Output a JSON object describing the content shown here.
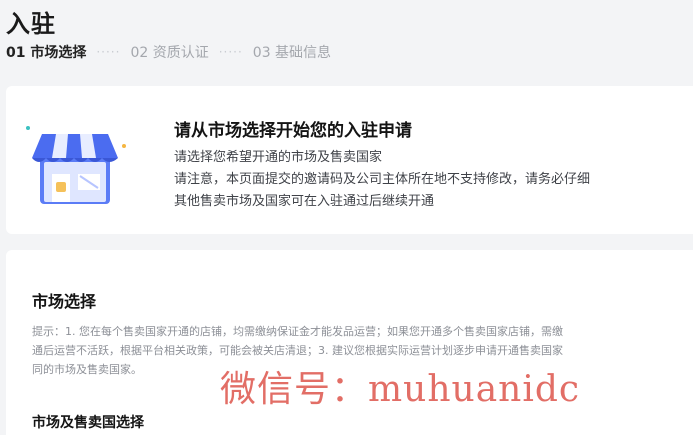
{
  "page": {
    "title": "入驻"
  },
  "steps": [
    {
      "label": "01 市场选择",
      "active": true
    },
    {
      "label": "02 资质认证",
      "active": false
    },
    {
      "label": "03 基础信息",
      "active": false
    }
  ],
  "step_separator": "·····",
  "intro": {
    "illustration_icon": "storefront-icon",
    "title": "请从市场选择开始您的入驻申请",
    "line1": "请选择您希望开通的市场及售卖国家",
    "line2": "请注意，本页面提交的邀请码及公司主体所在地不支持修改，请务必仔细",
    "line3": "其他售卖市场及国家可在入驻通过后继续开通"
  },
  "market": {
    "section_title": "市场选择",
    "notice_lines": [
      "提示：1. 您在每个售卖国家开通的店铺，均需缴纳保证金才能发品运营；如果您开通多个售卖国家店铺，需缴",
      "通后运营不活跃，根据平台相关政策，可能会被关店清退；3. 建议您根据实际运营计划逐步申请开通售卖国家",
      "同的市场及售卖国家。"
    ],
    "subsection_title": "市场及售卖国选择"
  },
  "watermark": "微信号：muhuanidc",
  "colors": {
    "store_awning": "#4b6cf0",
    "store_awning_light": "#e8edff",
    "store_body": "#5b7cf6",
    "watermark": "#e0625a"
  }
}
